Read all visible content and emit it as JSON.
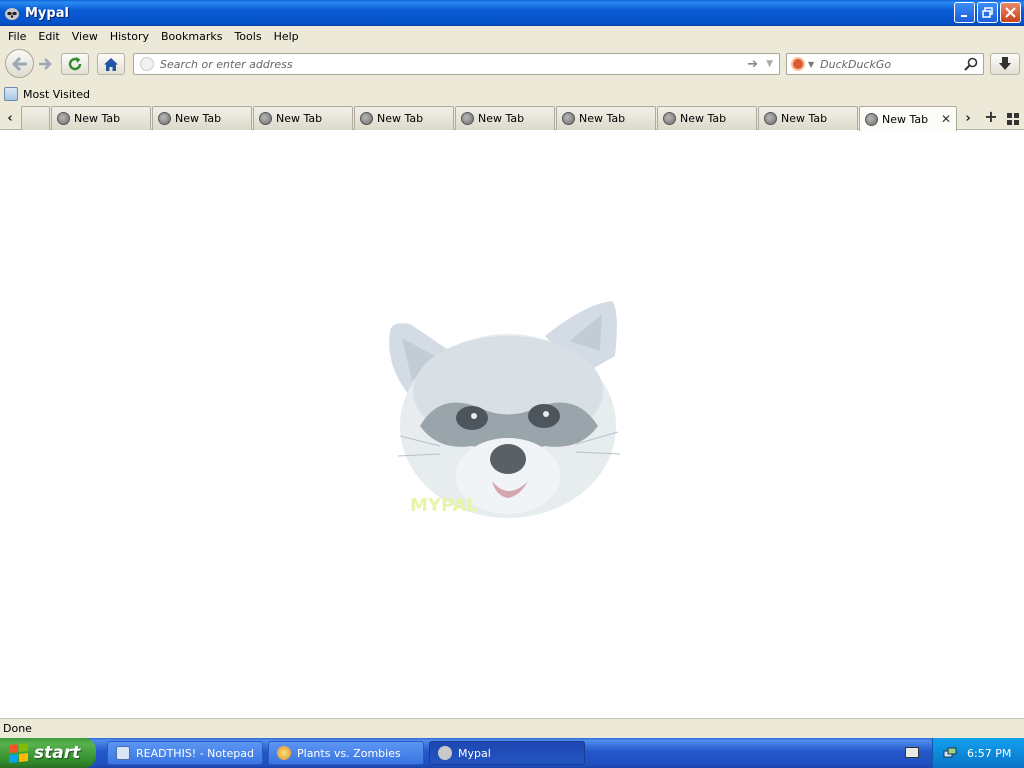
{
  "window": {
    "title": "Mypal"
  },
  "menubar": {
    "items": [
      "File",
      "Edit",
      "View",
      "History",
      "Bookmarks",
      "Tools",
      "Help"
    ]
  },
  "navbar": {
    "address_placeholder": "Search or enter address",
    "search_engine": "DuckDuckGo",
    "search_placeholder": "DuckDuckGo"
  },
  "bookmarks": {
    "items": [
      {
        "label": "Most Visited"
      }
    ]
  },
  "tabs": [
    {
      "label": "",
      "active": false
    },
    {
      "label": "New Tab",
      "active": false
    },
    {
      "label": "New Tab",
      "active": false
    },
    {
      "label": "New Tab",
      "active": false
    },
    {
      "label": "New Tab",
      "active": false
    },
    {
      "label": "New Tab",
      "active": false
    },
    {
      "label": "New Tab",
      "active": false
    },
    {
      "label": "New Tab",
      "active": false
    },
    {
      "label": "New Tab",
      "active": false
    },
    {
      "label": "New Tab",
      "active": true
    }
  ],
  "content": {
    "logo_text": "MYPAL"
  },
  "status": {
    "text": "Done"
  },
  "taskbar": {
    "start_label": "start",
    "tasks": [
      {
        "label": "READTHIS! - Notepad",
        "icon": "notepad-icon",
        "active": false
      },
      {
        "label": "Plants vs. Zombies",
        "icon": "game-icon",
        "active": false
      },
      {
        "label": "Mypal",
        "icon": "mypal-icon",
        "active": true
      }
    ],
    "clock": "6:57 PM"
  },
  "colors": {
    "titlebar": "#0453c8",
    "chrome": "#ece9d8",
    "taskbar": "#245edb",
    "start": "#3d9a3a",
    "tray": "#0d8adb"
  },
  "icons": [
    "mypal-icon",
    "back-icon",
    "forward-icon",
    "reload-icon",
    "home-icon",
    "go-icon",
    "search-icon",
    "download-icon",
    "globe-icon",
    "close-icon"
  ]
}
